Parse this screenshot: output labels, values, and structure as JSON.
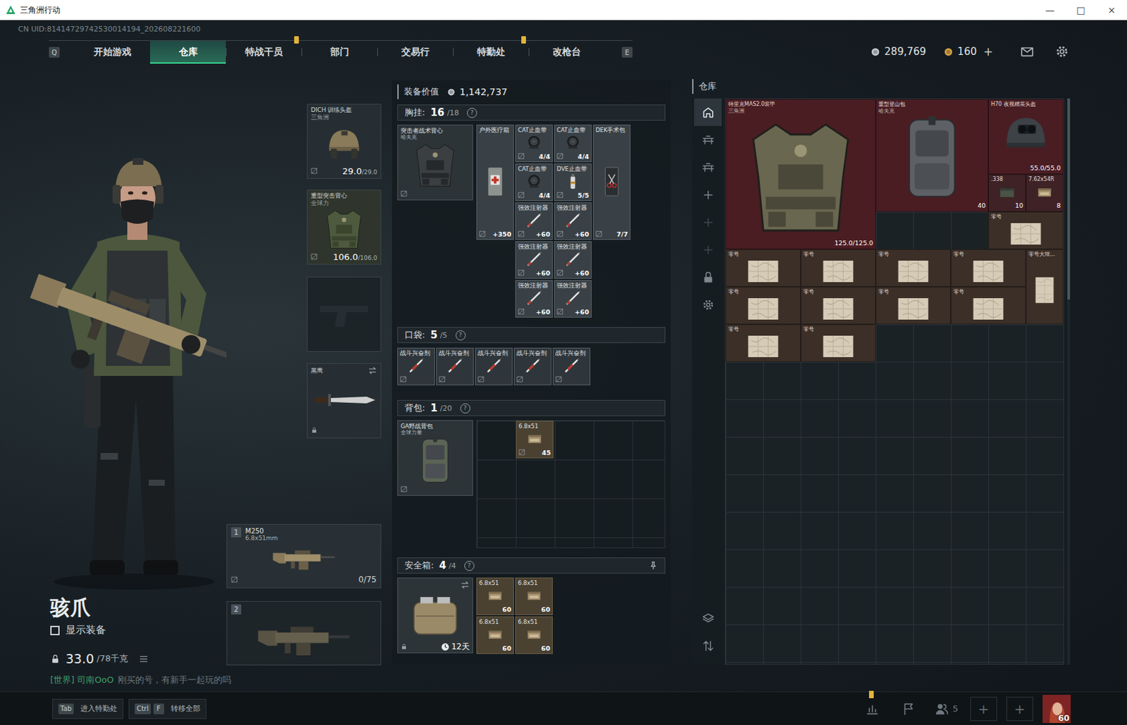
{
  "window": {
    "title": "三角洲行动",
    "controls": [
      "—",
      "□",
      "×"
    ]
  },
  "uid": "CN UID:81414729742530014194_202608221600",
  "nav": {
    "left_key": "Q",
    "right_key": "E",
    "tabs": [
      {
        "label": "开始游戏",
        "selected": false,
        "alert": false
      },
      {
        "label": "仓库",
        "selected": true,
        "alert": false
      },
      {
        "label": "特战干员",
        "selected": false,
        "alert": true
      },
      {
        "label": "部门",
        "selected": false,
        "alert": false
      },
      {
        "label": "交易行",
        "selected": false,
        "alert": false
      },
      {
        "label": "特勤处",
        "selected": false,
        "alert": true
      },
      {
        "label": "改枪台",
        "selected": false,
        "alert": false
      }
    ]
  },
  "currency": {
    "coins": "289,769",
    "bonds": "160",
    "add": "+"
  },
  "operator": {
    "name": "骇爪",
    "show_equipment": {
      "label": "显示装备",
      "checked": false
    },
    "weight": "33.0",
    "weight_max": "/78千克"
  },
  "chat": {
    "channel": "[世界] 司南OoO",
    "message": "刚买的号，有新手一起玩的吗"
  },
  "gear": {
    "helmet": {
      "name": "DICH 训练头盔",
      "brand": "三角洲",
      "value": "29.0",
      "max": "/29.0"
    },
    "armor": {
      "name": "重型突击背心",
      "brand": "全球力",
      "value": "106.0",
      "max": "/106.0"
    },
    "pistol": {
      "kind": "empty"
    },
    "melee": {
      "name": "黑鹰",
      "locked": true
    },
    "weapons": [
      {
        "slot": "1",
        "name": "M250",
        "caliber": "6.8x51mm",
        "ammo": "0/75",
        "kind": "gun"
      },
      {
        "slot": "2",
        "kind": "empty"
      }
    ]
  },
  "loadout": {
    "value_label": "装备价值",
    "value": "1,142,737",
    "chest": {
      "label": "胸挂:",
      "count": "16",
      "capacity": "/18",
      "help": "?",
      "rig": {
        "name": "突击者战术背心",
        "brand": "哈夫克"
      },
      "items": [
        {
          "name": "户外医疗箱",
          "value": "+350",
          "kind": "medkit"
        },
        {
          "name": "CAT止血带",
          "value": "4/4",
          "kind": "tourniquet"
        },
        {
          "name": "CAT止血带",
          "value": "4/4",
          "kind": "tourniquet"
        },
        {
          "name": "CAT止血带",
          "value": "4/4",
          "kind": "tourniquet"
        },
        {
          "name": "DVE止血带",
          "value": "5/5",
          "kind": "spray"
        },
        {
          "name": "DEK手术包",
          "value": "7/7",
          "kind": "surgery"
        },
        {
          "name": "强效注射器",
          "value": "+60",
          "kind": "injector"
        },
        {
          "name": "强效注射器",
          "value": "+60",
          "kind": "injector"
        },
        {
          "name": "强效注射器",
          "value": "+60",
          "kind": "injector"
        },
        {
          "name": "强效注射器",
          "value": "+60",
          "kind": "injector"
        },
        {
          "name": "强效注射器",
          "value": "+60",
          "kind": "injector"
        },
        {
          "name": "强效注射器",
          "value": "+60",
          "kind": "injector"
        }
      ]
    },
    "pocket": {
      "label": "口袋:",
      "count": "5",
      "capacity": "/5",
      "help": "?",
      "items": [
        {
          "name": "战斗兴奋剂",
          "kind": "stim"
        },
        {
          "name": "战斗兴奋剂",
          "kind": "stim"
        },
        {
          "name": "战斗兴奋剂",
          "kind": "stim"
        },
        {
          "name": "战斗兴奋剂",
          "kind": "stim"
        },
        {
          "name": "战斗兴奋剂",
          "kind": "stim"
        }
      ]
    },
    "backpack": {
      "label": "背包:",
      "count": "1",
      "capacity": "/20",
      "help": "?",
      "bag": {
        "name": "GA野战背包",
        "brand": "全球力量"
      },
      "items": [
        {
          "name": "6.8x51",
          "value": "45",
          "kind": "ammo"
        }
      ]
    },
    "safe": {
      "label": "安全箱:",
      "count": "4",
      "capacity": "/4",
      "help": "?",
      "pinned": true,
      "timer": "12天",
      "locked": true,
      "items": [
        {
          "name": "6.8x51",
          "value": "60",
          "kind": "ammo"
        },
        {
          "name": "6.8x51",
          "value": "60",
          "kind": "ammo"
        },
        {
          "name": "6.8x51",
          "value": "60",
          "kind": "ammo"
        },
        {
          "name": "6.8x51",
          "value": "60",
          "kind": "ammo"
        }
      ]
    }
  },
  "warehouse": {
    "title": "仓库",
    "sidebar_top": [
      {
        "kind": "home",
        "selected": true,
        "dim": false
      },
      {
        "kind": "rack",
        "selected": false,
        "dim": false
      },
      {
        "kind": "rack",
        "selected": false,
        "dim": false
      },
      {
        "kind": "plus",
        "selected": false,
        "dim": false
      },
      {
        "kind": "plus",
        "selected": false,
        "dim": true
      },
      {
        "kind": "plus",
        "selected": false,
        "dim": true
      },
      {
        "kind": "lock",
        "selected": false,
        "dim": false
      },
      {
        "kind": "gear",
        "selected": false,
        "dim": false
      }
    ],
    "sidebar_bottom": [
      {
        "kind": "layers",
        "selected": false,
        "dim": false
      },
      {
        "kind": "sort",
        "selected": false,
        "dim": false
      }
    ],
    "items": [
      {
        "name": "特里克MAS2.0装甲",
        "brand": "三角洲",
        "value": "125.0/125.0",
        "kind": "armor",
        "color": "#4a1d23"
      },
      {
        "name": "重型登山包",
        "brand": "哈夫克",
        "value": "40",
        "kind": "backpack",
        "color": "#4a1d23"
      },
      {
        "name": "H70 夜视精英头盔",
        "brand": "",
        "value": "55.0/55.0",
        "kind": "helmet",
        "color": "#4a1d23"
      },
      {
        "name": ".338",
        "brand": "",
        "value": "10",
        "kind": "ammo-box",
        "color": "#3f2226"
      },
      {
        "name": "7.62x54R",
        "brand": "",
        "value": "8",
        "kind": "ammo",
        "color": "#3f2226"
      },
      {
        "name": "零号",
        "brand": "",
        "value": "",
        "kind": "map",
        "color": "#3b2f28"
      },
      {
        "name": "零号",
        "brand": "",
        "value": "",
        "kind": "map",
        "color": "#3b2f28"
      },
      {
        "name": "零号",
        "brand": "",
        "value": "",
        "kind": "map",
        "color": "#3b2f28"
      },
      {
        "name": "零号",
        "brand": "",
        "value": "",
        "kind": "map",
        "color": "#3b2f28"
      },
      {
        "name": "零号",
        "brand": "",
        "value": "",
        "kind": "map",
        "color": "#3b2f28"
      },
      {
        "name": "零号大坝...",
        "brand": "",
        "value": "",
        "kind": "map-tall",
        "color": "#3b2f28"
      },
      {
        "name": "零号",
        "brand": "",
        "value": "",
        "kind": "map",
        "color": "#3b2f28"
      },
      {
        "name": "零号",
        "brand": "",
        "value": "",
        "kind": "map",
        "color": "#3b2f28"
      },
      {
        "name": "零号",
        "brand": "",
        "value": "",
        "kind": "map",
        "color": "#3b2f28"
      },
      {
        "name": "零号",
        "brand": "",
        "value": "",
        "kind": "map",
        "color": "#3b2f28"
      },
      {
        "name": "零号",
        "brand": "",
        "value": "",
        "kind": "map",
        "color": "#3b2f28"
      },
      {
        "name": "零号",
        "brand": "",
        "value": "",
        "kind": "map",
        "color": "#3b2f28"
      }
    ]
  },
  "hints": [
    {
      "keys": [
        "Tab"
      ],
      "label": "进入特勤处"
    },
    {
      "keys": [
        "Ctrl",
        "F"
      ],
      "label": "转移全部"
    }
  ],
  "social": {
    "stats_alert": true,
    "friends": "5",
    "add": [
      "+",
      "+"
    ],
    "level": "60"
  }
}
